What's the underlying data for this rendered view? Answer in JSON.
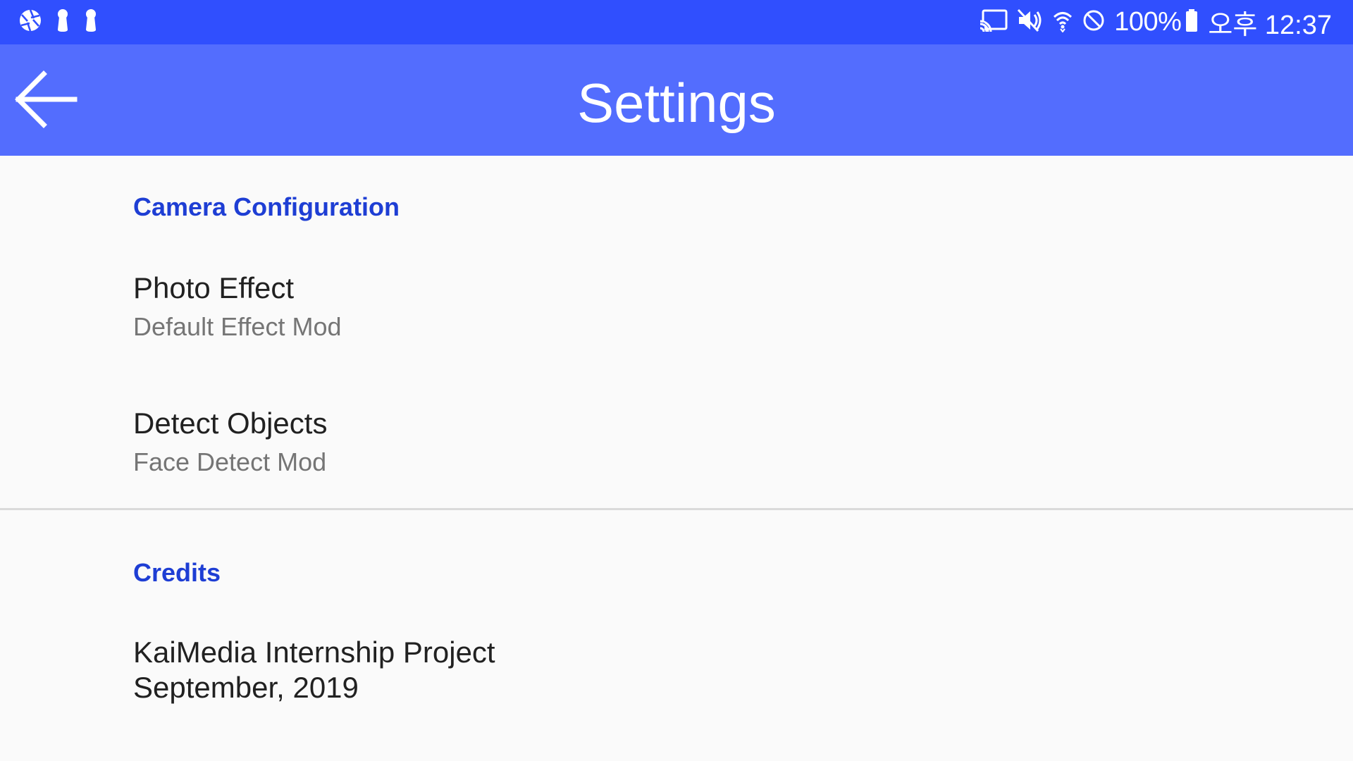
{
  "status_bar": {
    "left_icons": [
      "aperture-icon",
      "keyhole-icon",
      "keyhole-icon"
    ],
    "right_icons": [
      "cast-icon",
      "mute-icon",
      "wifi-icon",
      "do-not-disturb-icon",
      "battery-icon"
    ],
    "battery_text": "100%",
    "time": "오후 12:37",
    "color": "#304FFE"
  },
  "appbar": {
    "title": "Settings",
    "back_icon": "arrow-back-icon",
    "color": "#536DFE"
  },
  "sections": {
    "camera": {
      "header": "Camera Configuration",
      "photo_effect": {
        "title": "Photo Effect",
        "summary": "Default Effect Mod"
      },
      "detect_objects": {
        "title": "Detect Objects",
        "summary": "Face Detect Mod"
      }
    },
    "credits": {
      "header": "Credits",
      "line1": "KaiMedia Internship Project",
      "line2": "September, 2019"
    }
  },
  "accent_color": "#1E3ED4"
}
